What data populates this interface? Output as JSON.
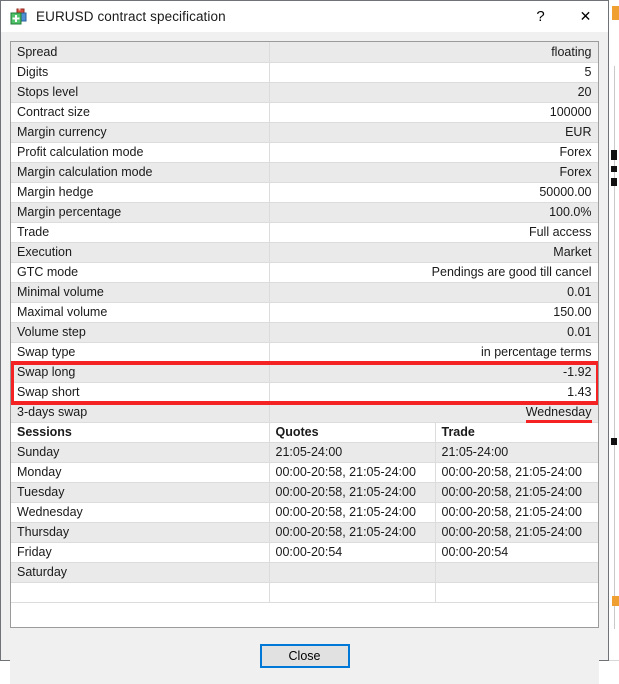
{
  "window": {
    "title": "EURUSD contract specification",
    "icon": "contract-spec-icon",
    "help_label": "?",
    "close_label": "✕"
  },
  "spec_rows": [
    {
      "key": "Spread",
      "value": "floating"
    },
    {
      "key": "Digits",
      "value": "5"
    },
    {
      "key": "Stops level",
      "value": "20"
    },
    {
      "key": "Contract size",
      "value": "100000"
    },
    {
      "key": "Margin currency",
      "value": "EUR"
    },
    {
      "key": "Profit calculation mode",
      "value": "Forex"
    },
    {
      "key": "Margin calculation mode",
      "value": "Forex"
    },
    {
      "key": "Margin hedge",
      "value": "50000.00"
    },
    {
      "key": "Margin percentage",
      "value": "100.0%"
    },
    {
      "key": "Trade",
      "value": "Full access"
    },
    {
      "key": "Execution",
      "value": "Market"
    },
    {
      "key": "GTC mode",
      "value": "Pendings are good till cancel"
    },
    {
      "key": "Minimal volume",
      "value": "0.01"
    },
    {
      "key": "Maximal volume",
      "value": "150.00"
    },
    {
      "key": "Volume step",
      "value": "0.01"
    },
    {
      "key": "Swap type",
      "value": "in percentage terms"
    },
    {
      "key": "Swap long",
      "value": "-1.92"
    },
    {
      "key": "Swap short",
      "value": "1.43"
    },
    {
      "key": "3-days swap",
      "value": "Wednesday"
    }
  ],
  "sessions": {
    "headers": [
      "Sessions",
      "Quotes",
      "Trade"
    ],
    "rows": [
      {
        "day": "Sunday",
        "quotes": "21:05-24:00",
        "trade": "21:05-24:00"
      },
      {
        "day": "Monday",
        "quotes": "00:00-20:58, 21:05-24:00",
        "trade": "00:00-20:58, 21:05-24:00"
      },
      {
        "day": "Tuesday",
        "quotes": "00:00-20:58, 21:05-24:00",
        "trade": "00:00-20:58, 21:05-24:00"
      },
      {
        "day": "Wednesday",
        "quotes": "00:00-20:58, 21:05-24:00",
        "trade": "00:00-20:58, 21:05-24:00"
      },
      {
        "day": "Thursday",
        "quotes": "00:00-20:58, 21:05-24:00",
        "trade": "00:00-20:58, 21:05-24:00"
      },
      {
        "day": "Friday",
        "quotes": "00:00-20:54",
        "trade": "00:00-20:54"
      },
      {
        "day": "Saturday",
        "quotes": "",
        "trade": ""
      }
    ]
  },
  "annotations": {
    "highlight_color": "#f42222",
    "boxed_rows": [
      "Swap long",
      "Swap short"
    ],
    "underlined_value": "Wednesday"
  },
  "footer": {
    "close_label": "Close"
  },
  "colors": {
    "accent": "#0078d7",
    "row_alt": "#eaeaea",
    "row_plain": "#ffffff",
    "dialog_bg": "#f0f0f0",
    "border": "#9b9b9b"
  }
}
